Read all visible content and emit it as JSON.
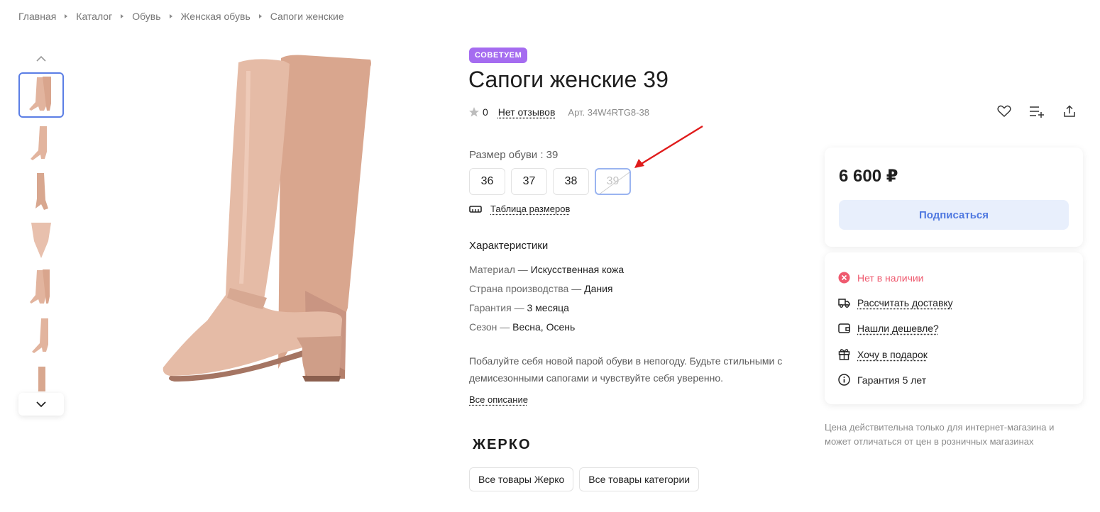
{
  "breadcrumb": [
    "Главная",
    "Каталог",
    "Обувь",
    "Женская обувь",
    "Сапоги женские"
  ],
  "product": {
    "badge": "СОВЕТУЕМ",
    "title": "Сапоги женские 39",
    "rating": "0",
    "reviews_label": "Нет отзывов",
    "sku": "Арт. 34W4RTG8-38"
  },
  "sizes": {
    "label": "Размер обуви : 39",
    "options": [
      "36",
      "37",
      "38",
      "39"
    ],
    "selected": "39",
    "table_link": "Таблица размеров"
  },
  "characteristics": {
    "title": "Характеристики",
    "rows": [
      {
        "key": "Материал — ",
        "value": "Искусственная кожа"
      },
      {
        "key": "Страна производства — ",
        "value": "Дания"
      },
      {
        "key": "Гарантия — ",
        "value": "3 месяца"
      },
      {
        "key": "Сезон — ",
        "value": "Весна, Осень"
      }
    ]
  },
  "description": {
    "text": "Побалуйте себя новой парой обуви в непогоду. Будьте стильными с демисезонными сапогами и чувствуйте себя уверенно.",
    "more_link": "Все описание"
  },
  "brand": {
    "name": "ЖЕРКО",
    "all_brand_label": "Все товары Жерко",
    "all_category_label": "Все товары категории"
  },
  "price_card": {
    "price": "6 600 ₽",
    "subscribe_label": "Подписаться"
  },
  "info_card": {
    "out_of_stock": "Нет в наличии",
    "delivery": "Рассчитать доставку",
    "cheaper": "Нашли дешевле?",
    "gift": "Хочу в подарок",
    "warranty": "Гарантия 5 лет"
  },
  "note": "Цена действительна только для интернет-магазина и может отличаться от цен в розничных магазинах",
  "icons": {
    "thumbs": [
      "boot-thumbnail",
      "boot-thumbnail",
      "boot-thumbnail",
      "boot-thumbnail",
      "boot-thumbnail",
      "boot-thumbnail",
      "boot-thumbnail"
    ]
  },
  "colors": {
    "accent": "#5b7ee5",
    "badge": "#a56cf0",
    "out_of_stock": "#ef5a6f",
    "boot": "#e2b49e",
    "arrow": "#e01b1b"
  }
}
